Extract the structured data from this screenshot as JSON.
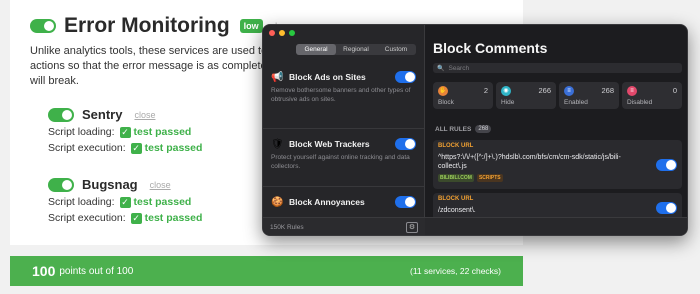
{
  "page": {
    "title": "Error Monitoring",
    "badge": "low",
    "close": "close",
    "description": "Unlike analytics tools, these services are used to track all user actions so that the error message is as complete as possible. They will break.",
    "services": [
      {
        "name": "Sentry",
        "close": "close",
        "lines": [
          {
            "label": "Script loading:",
            "status": "test passed"
          },
          {
            "label": "Script execution:",
            "status": "test passed"
          }
        ]
      },
      {
        "name": "Bugsnag",
        "close": "close",
        "lines": [
          {
            "label": "Script loading:",
            "status": "test passed"
          },
          {
            "label": "Script execution:",
            "status": "test passed"
          }
        ]
      }
    ],
    "score": {
      "value": "100",
      "text": "points out of 100",
      "details": "(11 services, 22 checks)"
    },
    "colors": {
      "green": "#3fb14a",
      "score_bar": "#4cb04e"
    }
  },
  "app": {
    "tabs": [
      "General",
      "Regional",
      "Custom"
    ],
    "active_tab": "General",
    "features": [
      {
        "icon": "megaphone-icon",
        "title": "Block Ads on Sites",
        "desc": "Remove bothersome banners and other types of obtrusive ads on sites.",
        "enabled": true
      },
      {
        "icon": "shield-icon",
        "title": "Block Web Trackers",
        "desc": "Protect yourself against online tracking and data collectors.",
        "enabled": true
      },
      {
        "icon": "cookie-icon",
        "title": "Block Annoyances",
        "desc": "",
        "enabled": true
      }
    ],
    "footer": {
      "rules_count": "150K Rules"
    },
    "panel": {
      "title": "Block Comments",
      "search_placeholder": "Search",
      "stats": [
        {
          "label": "Block",
          "count": "2",
          "color": "#e8833a",
          "icon": "hand-icon"
        },
        {
          "label": "Hide",
          "count": "266",
          "color": "#2fb5c8",
          "icon": "eye-icon"
        },
        {
          "label": "Enabled",
          "count": "268",
          "color": "#3a6fd8",
          "icon": "stack-icon"
        },
        {
          "label": "Disabled",
          "count": "0",
          "color": "#e2486b",
          "icon": "stack-off-icon"
        }
      ],
      "all_rules_label": "ALL RULES",
      "all_rules_count": "268",
      "rules": [
        {
          "type": "BLOCK URL",
          "url": "^https?:\\/\\/+([^:/]+\\.)?hdslb\\.com/bfs/cm/cm-sdk/static/js/bili-collect\\.js",
          "tags": [
            "BILIBILI.COM",
            "SCRIPTS"
          ],
          "enabled": true
        },
        {
          "type": "BLOCK URL",
          "url": "/zdconsent\\.",
          "tags": [],
          "enabled": true
        }
      ]
    }
  }
}
